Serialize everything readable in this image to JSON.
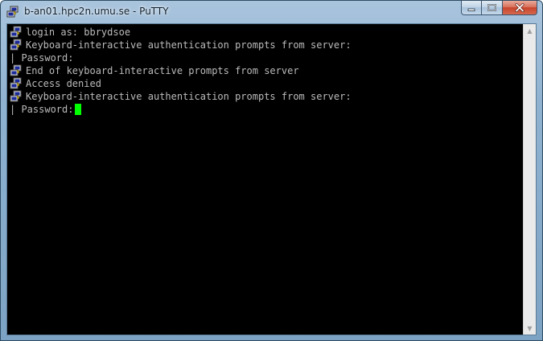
{
  "window": {
    "title": "b-an01.hpc2n.umu.se - PuTTY",
    "icon": "putty-icon"
  },
  "caption": {
    "minimize_icon": "minimize-icon",
    "maximize_icon": "maximize-icon",
    "close_icon": "close-icon"
  },
  "terminal": {
    "lines": [
      {
        "prefix": "putty-icon",
        "text": "login as: bbrydsoe"
      },
      {
        "prefix": "putty-icon",
        "text": "Keyboard-interactive authentication prompts from server:"
      },
      {
        "prefix": "pipe",
        "text": "| Password:"
      },
      {
        "prefix": "putty-icon",
        "text": "End of keyboard-interactive prompts from server"
      },
      {
        "prefix": "putty-icon",
        "text": "Access denied"
      },
      {
        "prefix": "putty-icon",
        "text": "Keyboard-interactive authentication prompts from server:"
      },
      {
        "prefix": "pipe",
        "text": "| Password:"
      }
    ],
    "foreground": "#bbbbbb",
    "background": "#000000",
    "cursor_color": "#00ff00"
  },
  "scrollbar": {
    "up_arrow": "▲",
    "down_arrow": "▼"
  }
}
